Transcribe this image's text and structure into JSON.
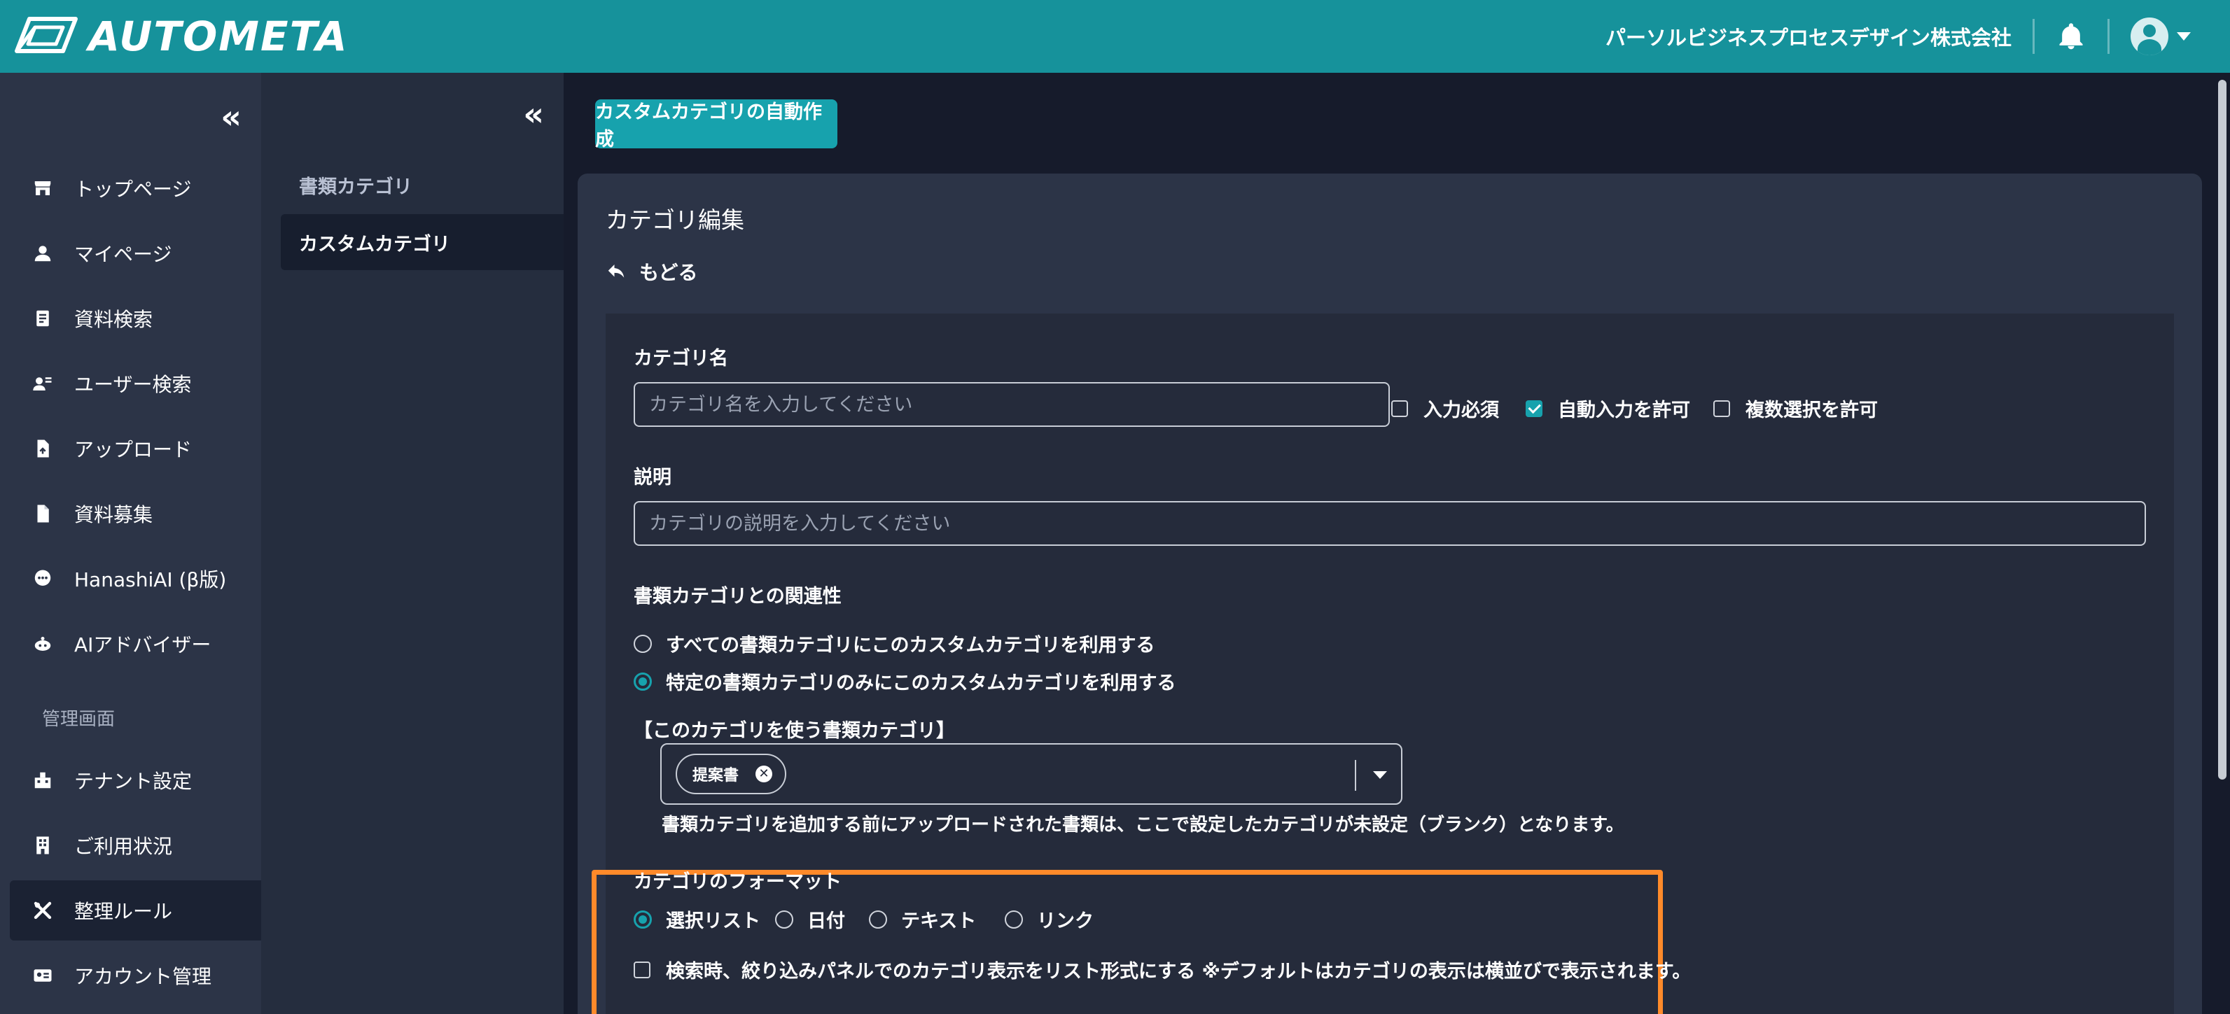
{
  "header": {
    "logo_text": "AUTOMETA",
    "company": "パーソルビジネスプロセスデザイン株式会社",
    "bell_icon": "bell-icon",
    "avatar_icon": "user-avatar-icon"
  },
  "nav": {
    "collapse": "«",
    "items": [
      {
        "label": "トップページ",
        "icon": "store-icon"
      },
      {
        "label": "マイページ",
        "icon": "person-icon"
      },
      {
        "label": "資料検索",
        "icon": "document-search-icon"
      },
      {
        "label": "ユーザー検索",
        "icon": "user-search-icon"
      },
      {
        "label": "アップロード",
        "icon": "upload-file-icon"
      },
      {
        "label": "資料募集",
        "icon": "file-icon"
      },
      {
        "label": "HanashiAI (β版)",
        "icon": "chat-icon"
      },
      {
        "label": "AIアドバイザー",
        "icon": "robot-icon"
      }
    ],
    "section_label": "管理画面",
    "admin_items": [
      {
        "label": "テナント設定",
        "icon": "tenant-icon"
      },
      {
        "label": "ご利用状況",
        "icon": "building-icon"
      },
      {
        "label": "整理ルール",
        "icon": "tools-icon"
      },
      {
        "label": "アカウント管理",
        "icon": "id-card-icon"
      }
    ]
  },
  "subnav": {
    "collapse": "«",
    "items": [
      {
        "label": "書類カテゴリ"
      },
      {
        "label": "カスタムカテゴリ"
      }
    ]
  },
  "main": {
    "auto_create_button": "カスタムカテゴリの自動作成",
    "card_title": "カテゴリ編集",
    "back_label": "もどる",
    "category_name": {
      "label": "カテゴリ名",
      "placeholder": "カテゴリ名を入力してください",
      "value": ""
    },
    "options": [
      {
        "label": "入力必須",
        "checked": false
      },
      {
        "label": "自動入力を許可",
        "checked": true
      },
      {
        "label": "複数選択を許可",
        "checked": false
      }
    ],
    "description": {
      "label": "説明",
      "placeholder": "カテゴリの説明を入力してください",
      "value": ""
    },
    "relation": {
      "label": "書類カテゴリとの関連性",
      "options": [
        {
          "label": "すべての書類カテゴリにこのカスタムカテゴリを利用する",
          "selected": false
        },
        {
          "label": "特定の書類カテゴリのみにこのカスタムカテゴリを利用する",
          "selected": true
        }
      ]
    },
    "target": {
      "label": "【このカテゴリを使う書類カテゴリ】",
      "chips": [
        "提案書"
      ],
      "chip_remove": "✕",
      "note": "書類カテゴリを追加する前にアップロードされた書類は、ここで設定したカテゴリが未設定（ブランク）となります。"
    },
    "format": {
      "label": "カテゴリのフォーマット",
      "options": [
        {
          "label": "選択リスト",
          "selected": true
        },
        {
          "label": "日付",
          "selected": false
        },
        {
          "label": "テキスト",
          "selected": false
        },
        {
          "label": "リンク",
          "selected": false
        }
      ]
    },
    "list_display": {
      "label": "検索時、絞り込みパネルでのカテゴリ表示をリスト形式にする ※デフォルトはカテゴリの表示は横並びで表示されます。",
      "checked": false
    }
  },
  "colors": {
    "header": "#16929b",
    "accent": "#17a2ad",
    "highlight": "#ff8a2a",
    "nav_bg": "#2c3447",
    "main_bg": "#161b2b"
  }
}
